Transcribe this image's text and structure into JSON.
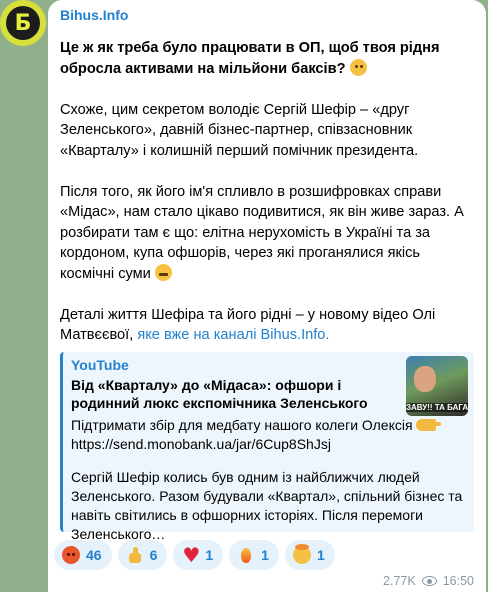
{
  "channel": {
    "name": "Bihus.Info",
    "avatar_letter": "Б"
  },
  "message": {
    "p1": "Це ж як треба було працювати в ОП, щоб твоя рідня обросла активами на мільйони баксів?",
    "p1_emoji": "thinking-face",
    "p2": "Схоже, цим секретом володіє Сергій Шефір – «друг Зеленського», давній бізнес-партнер, співзасновник «Кварталу» і колишній перший помічник президента.",
    "p3": "Після того, як його ім'я спливло в розшифровках справи «Мідас», нам стало цікаво подивитися, як він живе зараз. А розбирати там є що: елітна нерухомість в Україні та за кордоном, купа офшорів, через які проганялися якісь космічні суми",
    "p3_emoji": "grimacing-face",
    "p4_prefix": "Деталі життя Шефіра та його рідні – у новому відео Олі Матвєєвої,",
    "p4_link": "яке вже на каналі Bihus.Info."
  },
  "preview": {
    "site": "YouTube",
    "title": "Від «Кварталу» до «Мідаса»: офшори і родинний люкс експомічника Зеленського",
    "desc1_prefix": "Підтримати збір для медбату нашого колеги Олексія",
    "desc1_url": "https://send.monobank.ua/jar/6Cup8ShJsj",
    "desc2": "Сергій Шефір колись був одним із найближчих людей Зеленського. Разом будували «Квартал», спільний бізнес та навіть світились в офшорних історіях. Після перемоги Зеленського…",
    "thumb_caption": "ЗАВУ!! ТА БАГАТ РУЗІ ПРЕЗИДЕНТ"
  },
  "reactions": [
    {
      "icon": "angry-face-icon",
      "count": "46"
    },
    {
      "icon": "thumbs-up-icon",
      "count": "6"
    },
    {
      "icon": "heart-icon",
      "count": "1"
    },
    {
      "icon": "fire-icon",
      "count": "1"
    },
    {
      "icon": "exploding-head-icon",
      "count": "1"
    }
  ],
  "meta": {
    "views": "2.77K",
    "time": "16:50"
  },
  "colors": {
    "background": "#8fb08b",
    "accent": "#2481cc",
    "avatar_ring": "#d7e03a"
  }
}
